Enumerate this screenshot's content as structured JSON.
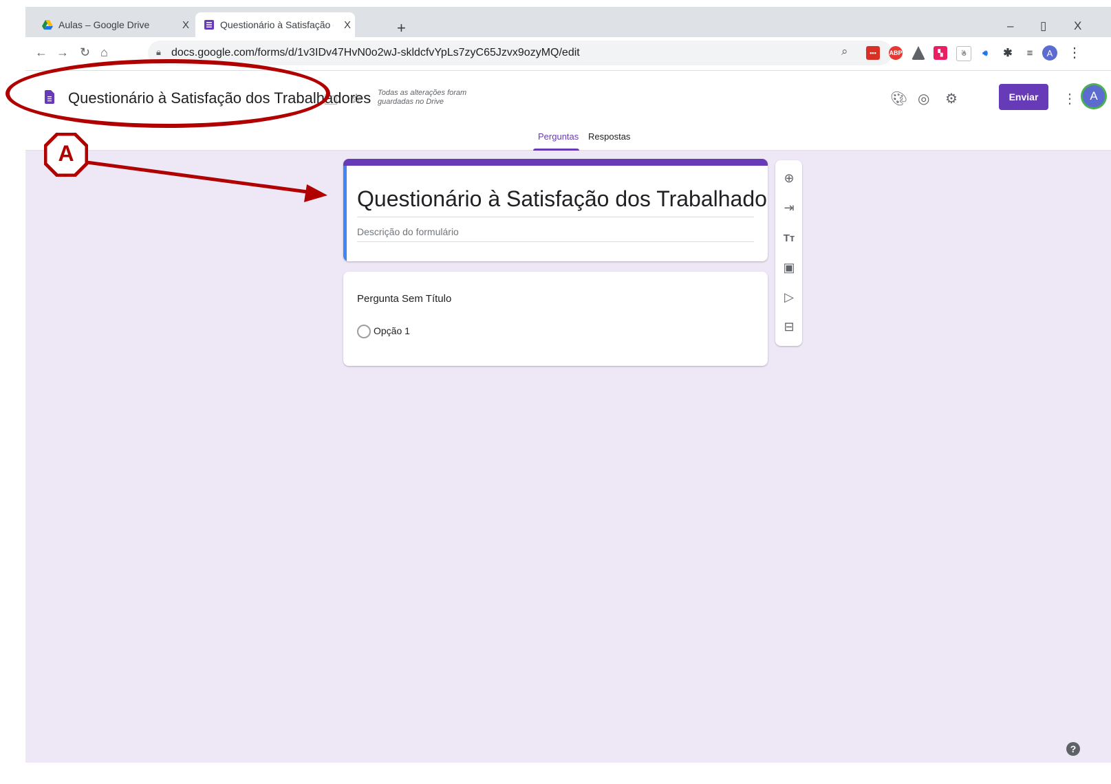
{
  "browser": {
    "tabs": [
      {
        "title": "Aulas – Google Drive",
        "close": "X",
        "icon": "google-drive-icon"
      },
      {
        "title": "Questionário à Satisfação dos Tra",
        "close": "X",
        "icon": "google-forms-icon"
      }
    ],
    "new_tab": "+",
    "window_controls": {
      "minimize": "–",
      "maximize": "▯",
      "close": "X"
    },
    "url": "docs.google.com/forms/d/1v3IDv47HvN0o2wJ-skldcfvYpLs7zyC65Jzvx9ozyMQ/edit",
    "profile_initial": "A",
    "extension_abp": "ABP"
  },
  "header": {
    "doc_title": "Questionário à Satisfação dos Trabalhadores",
    "saved_status": "Todas as alterações foram guardadas no Drive",
    "send_label": "Enviar",
    "avatar_initial": "A",
    "tabs": {
      "questions": "Perguntas",
      "responses": "Respostas"
    }
  },
  "form": {
    "title": "Questionário à Satisfação dos Trabalhadores",
    "description_placeholder": "Descrição do formulário",
    "question": {
      "title": "Pergunta Sem Título",
      "option": "Opção 1"
    }
  },
  "annotation": {
    "marker": "A",
    "color": "#b00000"
  },
  "colors": {
    "accent": "#673ab7",
    "canvas": "#ede7f6",
    "left_bar": "#4285f4"
  }
}
